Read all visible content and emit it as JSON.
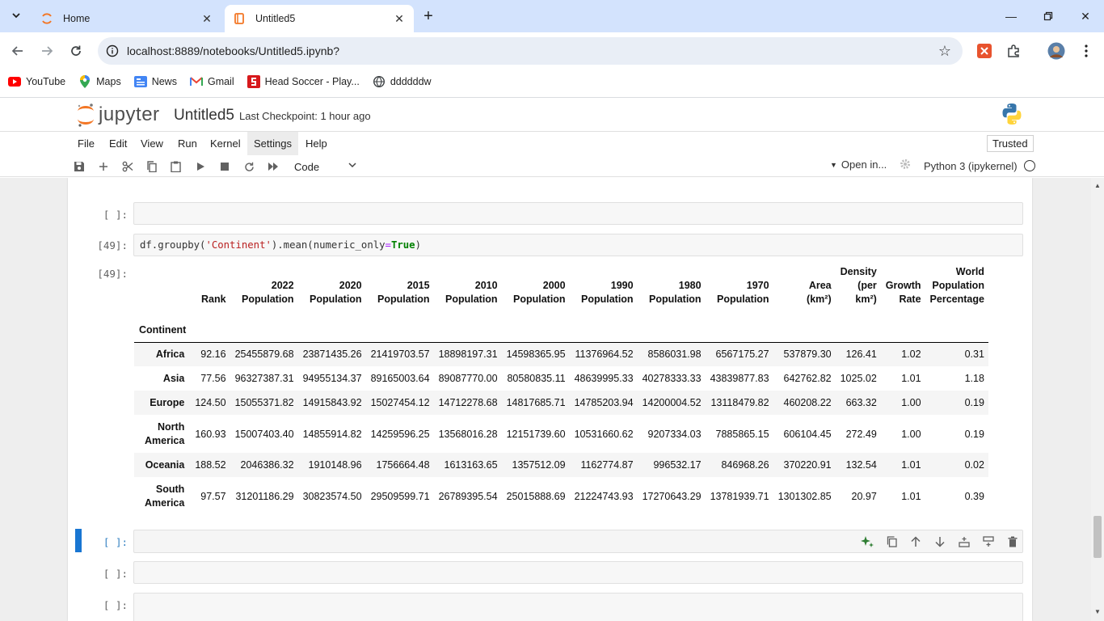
{
  "browser": {
    "tabs": [
      {
        "title": "Home",
        "active": false
      },
      {
        "title": "Untitled5",
        "active": true
      }
    ],
    "url": "localhost:8889/notebooks/Untitled5.ipynb?",
    "bookmarks": [
      "YouTube",
      "Maps",
      "News",
      "Gmail",
      "Head Soccer - Play...",
      "ddddddw"
    ]
  },
  "jupyter": {
    "logo_text": "jupyter",
    "notebook_name": "Untitled5",
    "checkpoint": "Last Checkpoint: 1 hour ago",
    "menu": [
      "File",
      "Edit",
      "View",
      "Run",
      "Kernel",
      "Settings",
      "Help"
    ],
    "trusted_label": "Trusted",
    "cell_type": "Code",
    "open_in_label": "Open in...",
    "kernel_name": "Python 3 (ipykernel)"
  },
  "cells": {
    "empty_prompt": "[ ]:",
    "code_prompt": "[49]:",
    "output_prompt": "[49]:",
    "code_parts": {
      "obj": "df.groupby(",
      "arg1": "'Continent'",
      "mid": ").mean(numeric_only",
      "eq": "=",
      "kw": "True",
      "end": ")"
    }
  },
  "table": {
    "index_name": "Continent",
    "columns": [
      [
        "Rank"
      ],
      [
        "2022",
        "Population"
      ],
      [
        "2020",
        "Population"
      ],
      [
        "2015",
        "Population"
      ],
      [
        "2010",
        "Population"
      ],
      [
        "2000",
        "Population"
      ],
      [
        "1990",
        "Population"
      ],
      [
        "1980",
        "Population"
      ],
      [
        "1970",
        "Population"
      ],
      [
        "Area",
        "(km²)"
      ],
      [
        "Density",
        "(per",
        "km²)"
      ],
      [
        "Growth",
        "Rate"
      ],
      [
        "World",
        "Population",
        "Percentage"
      ]
    ],
    "rows": [
      {
        "name": [
          "Africa"
        ],
        "values": [
          "92.16",
          "25455879.68",
          "23871435.26",
          "21419703.57",
          "18898197.31",
          "14598365.95",
          "11376964.52",
          "8586031.98",
          "6567175.27",
          "537879.30",
          "126.41",
          "1.02",
          "0.31"
        ]
      },
      {
        "name": [
          "Asia"
        ],
        "values": [
          "77.56",
          "96327387.31",
          "94955134.37",
          "89165003.64",
          "89087770.00",
          "80580835.11",
          "48639995.33",
          "40278333.33",
          "43839877.83",
          "642762.82",
          "1025.02",
          "1.01",
          "1.18"
        ]
      },
      {
        "name": [
          "Europe"
        ],
        "values": [
          "124.50",
          "15055371.82",
          "14915843.92",
          "15027454.12",
          "14712278.68",
          "14817685.71",
          "14785203.94",
          "14200004.52",
          "13118479.82",
          "460208.22",
          "663.32",
          "1.00",
          "0.19"
        ]
      },
      {
        "name": [
          "North",
          "America"
        ],
        "values": [
          "160.93",
          "15007403.40",
          "14855914.82",
          "14259596.25",
          "13568016.28",
          "12151739.60",
          "10531660.62",
          "9207334.03",
          "7885865.15",
          "606104.45",
          "272.49",
          "1.00",
          "0.19"
        ]
      },
      {
        "name": [
          "Oceania"
        ],
        "values": [
          "188.52",
          "2046386.32",
          "1910148.96",
          "1756664.48",
          "1613163.65",
          "1357512.09",
          "1162774.87",
          "996532.17",
          "846968.26",
          "370220.91",
          "132.54",
          "1.01",
          "0.02"
        ]
      },
      {
        "name": [
          "South",
          "America"
        ],
        "values": [
          "97.57",
          "31201186.29",
          "30823574.50",
          "29509599.71",
          "26789395.54",
          "25015888.69",
          "21224743.93",
          "17270643.29",
          "13781939.71",
          "1301302.85",
          "20.97",
          "1.01",
          "0.39"
        ]
      }
    ]
  },
  "colors": {
    "tabstrip": "#d3e3fd",
    "accent": "#1976d2",
    "notebook_bg": "#eeeeee",
    "jupyter_orange": "#f37726"
  }
}
